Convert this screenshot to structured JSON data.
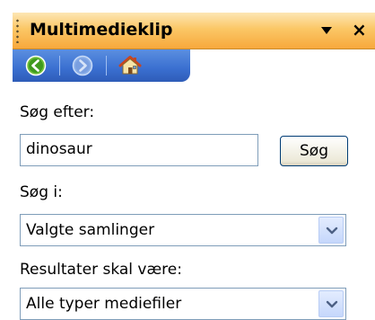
{
  "pane": {
    "title": "Multimedieklip",
    "menu_icon": "dropdown-arrow-icon",
    "close_glyph": "×"
  },
  "nav": {
    "back_icon": "back-icon",
    "forward_icon": "forward-icon",
    "home_icon": "home-icon"
  },
  "search": {
    "label": "Søg efter:",
    "value": "dinosaur",
    "button_label": "Søg"
  },
  "search_in": {
    "label": "Søg i:",
    "selected": "Valgte samlinger"
  },
  "results": {
    "label": "Resultater skal være:",
    "selected": "Alle typer mediefiler"
  },
  "colors": {
    "title_bar": "#f7a83c",
    "nav_bar": "#3a6fd0",
    "input_border": "#7f9db9"
  }
}
